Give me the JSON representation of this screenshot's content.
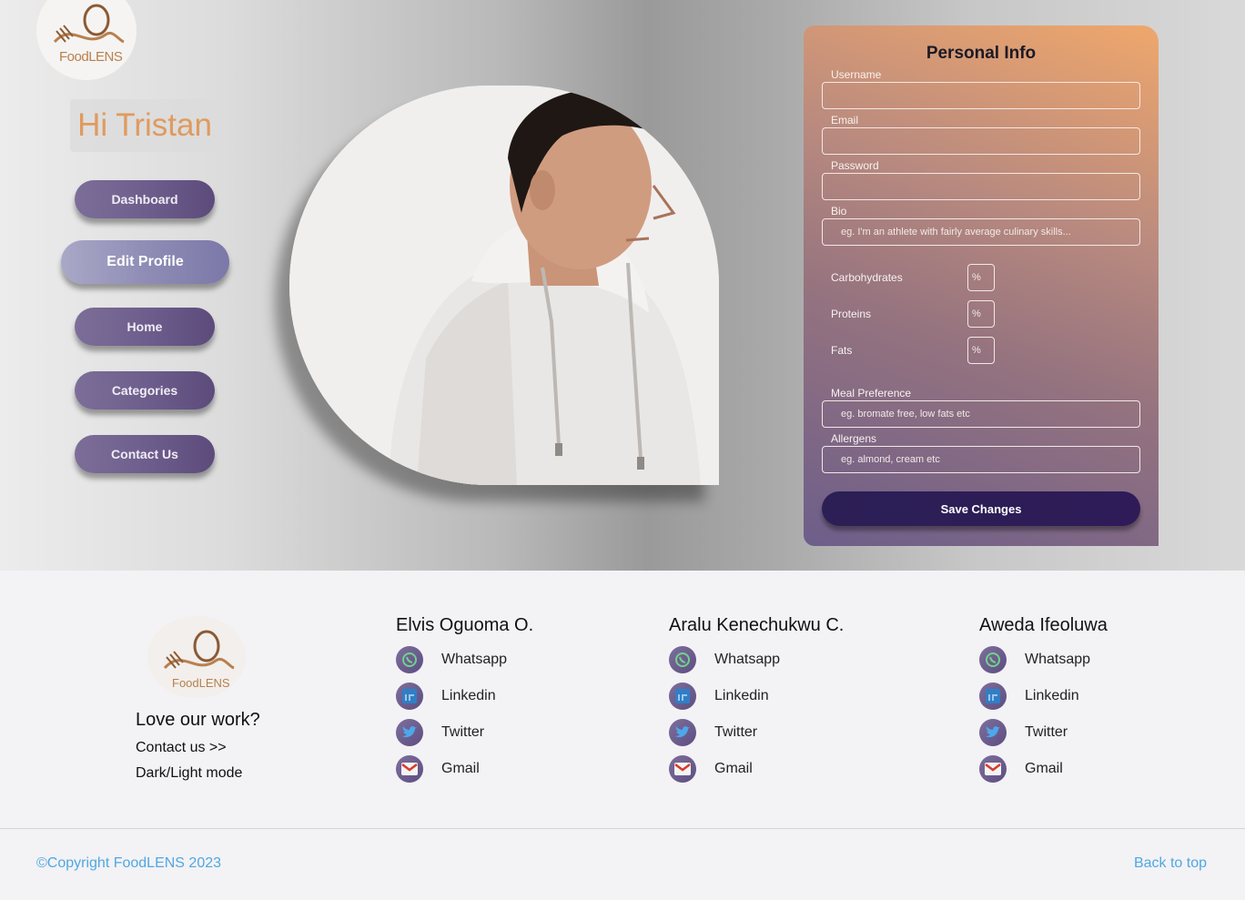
{
  "brand": {
    "logo_text": "FoodLENS"
  },
  "sidebar": {
    "greeting": "Hi Tristan",
    "nav": [
      {
        "label": "Dashboard"
      },
      {
        "label": "Edit Profile"
      },
      {
        "label": "Home"
      },
      {
        "label": "Categories"
      },
      {
        "label": "Contact Us"
      }
    ]
  },
  "form": {
    "title": "Personal Info",
    "username_label": "Username",
    "email_label": "Email",
    "password_label": "Password",
    "bio_label": "Bio",
    "bio_placeholder": "eg. I'm an athlete with fairly average culinary skills...",
    "carbs_label": "Carbohydrates",
    "proteins_label": "Proteins",
    "fats_label": "Fats",
    "macro_placeholder": "%",
    "meal_label": "Meal Preference",
    "meal_placeholder": "eg. bromate free, low fats etc",
    "allergens_label": "Allergens",
    "allergens_placeholder": "eg. almond, cream etc",
    "save_label": "Save Changes"
  },
  "footer": {
    "love": "Love our work?",
    "contact": "Contact us >>",
    "mode": "Dark/Light mode",
    "members": [
      {
        "name": "Elvis Oguoma O."
      },
      {
        "name": "Aralu Kenechukwu C."
      },
      {
        "name": "Aweda Ifeoluwa"
      }
    ],
    "socials": [
      "Whatsapp",
      "Linkedin",
      "Twitter",
      "Gmail"
    ],
    "copyright": "©Copyright FoodLENS 2023",
    "back_to_top": "Back to top"
  },
  "colors": {
    "accent": "#e09a5e",
    "nav": "#6e5e8d",
    "link": "#4fa8e3",
    "save": "#2c1f55"
  }
}
